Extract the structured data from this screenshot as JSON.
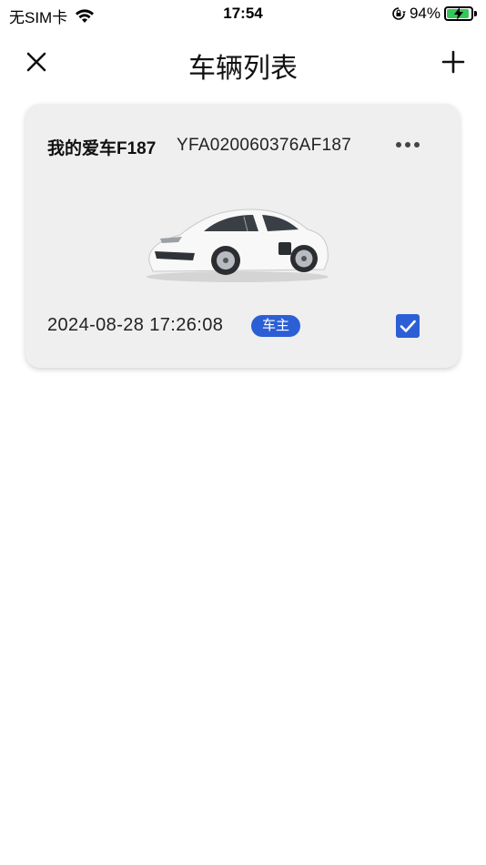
{
  "status_bar": {
    "carrier": "无SIM卡",
    "time": "17:54",
    "battery_percent": "94%",
    "battery_level": 0.94
  },
  "nav": {
    "title": "车辆列表",
    "close_icon": "close-icon",
    "add_icon": "plus-icon"
  },
  "vehicles": [
    {
      "name": "我的爱车F187",
      "vin": "YFA020060376AF187",
      "date": "2024-08-28 17:26:08",
      "role": "车主",
      "selected": true
    }
  ],
  "colors": {
    "accent": "#2c5fd6",
    "card_bg": "#efefef",
    "battery_green": "#34c759"
  }
}
